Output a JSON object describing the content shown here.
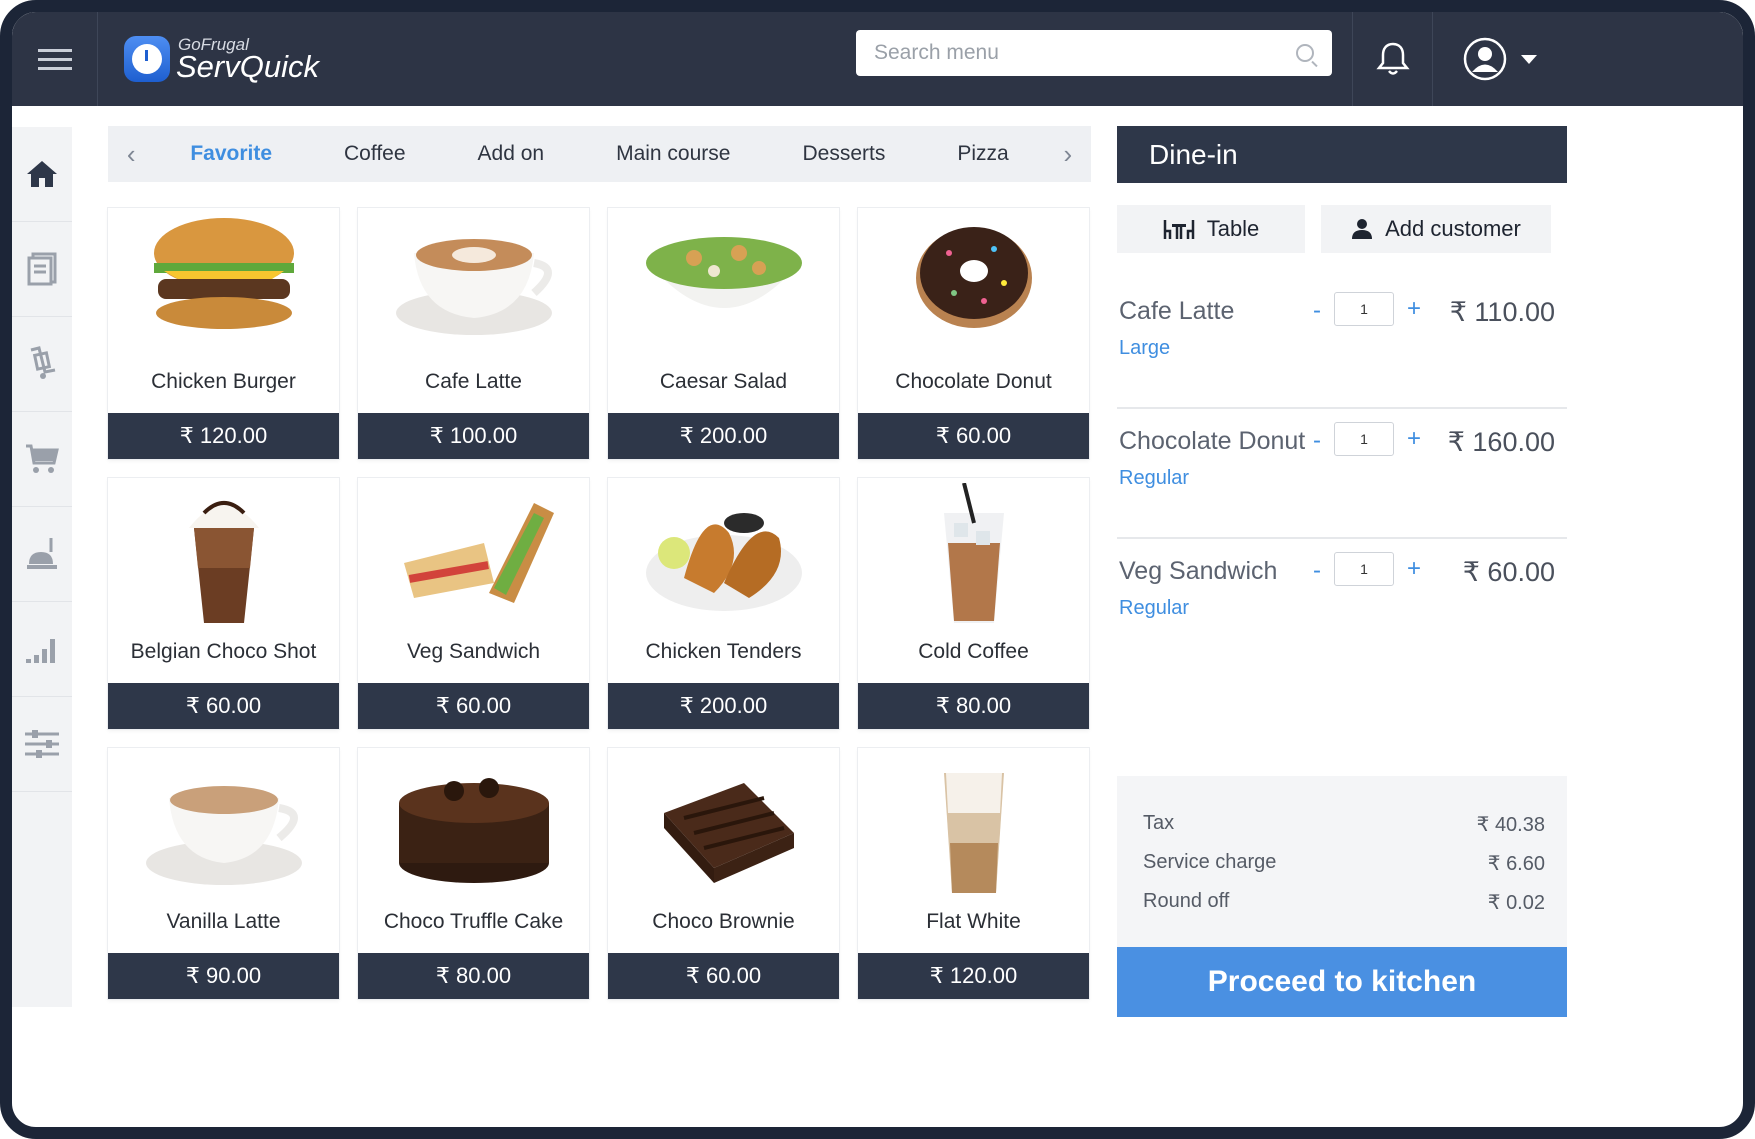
{
  "app": {
    "logo_sub": "GoFrugal",
    "logo_main": "ServQuick"
  },
  "search": {
    "placeholder": "Search menu"
  },
  "rail": {
    "items": [
      "home-icon",
      "orders-icon",
      "billing-icon",
      "cart-icon",
      "kitchen-icon",
      "reports-icon",
      "settings-icon"
    ]
  },
  "tabs": {
    "items": [
      "Favorite",
      "Coffee",
      "Add on",
      "Main course",
      "Desserts",
      "Pizza"
    ],
    "active": "Favorite"
  },
  "products": [
    {
      "name": "Chicken Burger",
      "price": "₹ 120.00",
      "icon": "burger-image"
    },
    {
      "name": "Cafe Latte",
      "price": "₹ 100.00",
      "icon": "latte-image"
    },
    {
      "name": "Caesar Salad",
      "price": "₹ 200.00",
      "icon": "salad-image"
    },
    {
      "name": "Chocolate Donut",
      "price": "₹ 60.00",
      "icon": "donut-image"
    },
    {
      "name": "Belgian Choco Shot",
      "price": "₹ 60.00",
      "icon": "choco-shot-image"
    },
    {
      "name": "Veg Sandwich",
      "price": "₹ 60.00",
      "icon": "sandwich-image"
    },
    {
      "name": "Chicken Tenders",
      "price": "₹ 200.00",
      "icon": "tenders-image"
    },
    {
      "name": "Cold Coffee",
      "price": "₹ 80.00",
      "icon": "cold-coffee-image"
    },
    {
      "name": "Vanilla Latte",
      "price": "₹ 90.00",
      "icon": "vanilla-latte-image"
    },
    {
      "name": "Choco Truffle Cake",
      "price": "₹ 80.00",
      "icon": "cake-image"
    },
    {
      "name": "Choco Brownie",
      "price": "₹ 60.00",
      "icon": "brownie-image"
    },
    {
      "name": "Flat White",
      "price": "₹ 120.00",
      "icon": "flat-white-image"
    }
  ],
  "order": {
    "title": "Dine-in",
    "table_label": "Table",
    "customer_label": "Add customer",
    "items": [
      {
        "name": "Cafe Latte",
        "variant": "Large",
        "qty": "1",
        "price": "₹ 110.00"
      },
      {
        "name": "Chocolate Donut",
        "variant": "Regular",
        "qty": "1",
        "price": "₹ 160.00"
      },
      {
        "name": "Veg Sandwich",
        "variant": "Regular",
        "qty": "1",
        "price": "₹ 60.00"
      }
    ],
    "minus_label": "-",
    "plus_label": "+",
    "summary": [
      {
        "label": "Tax",
        "value": "₹ 40.38"
      },
      {
        "label": "Service charge",
        "value": "₹ 6.60"
      },
      {
        "label": "Round off",
        "value": "₹ 0.02"
      }
    ],
    "proceed_label": "Proceed to kitchen"
  },
  "colors": {
    "topbar": "#2d3445",
    "accent": "#3f8ee0",
    "price_bar": "#2e3749",
    "proceed": "#4a90e2"
  }
}
